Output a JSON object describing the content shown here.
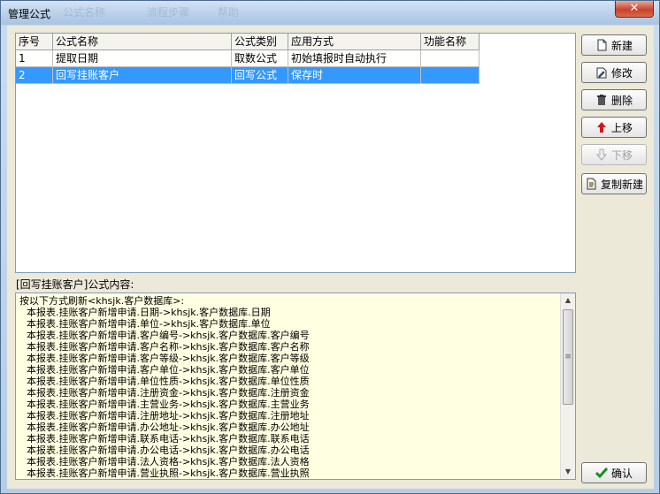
{
  "window": {
    "title": "管理公式",
    "ghost_texts": [
      "公式名称",
      "流程步骤",
      "帮助"
    ],
    "close_label": "✕"
  },
  "table": {
    "columns": [
      "序号",
      "公式名称",
      "公式类别",
      "应用方式",
      "功能名称"
    ],
    "rows": [
      [
        "1",
        "提取日期",
        "取数公式",
        "初始填报时自动执行",
        ""
      ],
      [
        "2",
        "回写挂账客户",
        "回写公式",
        "保存时",
        ""
      ]
    ],
    "selected_index": 1
  },
  "content_label": "[回写挂账客户]公式内容:",
  "content_lines": [
    "按以下方式刷新<khsjk.客户数据库>:",
    "本报表.挂账客户新增申请.日期->khsjk.客户数据库.日期",
    "本报表.挂账客户新增申请.单位->khsjk.客户数据库.单位",
    "本报表.挂账客户新增申请.客户编号->khsjk.客户数据库.客户编号",
    "本报表.挂账客户新增申请.客户名称->khsjk.客户数据库.客户名称",
    "本报表.挂账客户新增申请.客户等级->khsjk.客户数据库.客户等级",
    "本报表.挂账客户新增申请.客户单位->khsjk.客户数据库.客户单位",
    "本报表.挂账客户新增申请.单位性质->khsjk.客户数据库.单位性质",
    "本报表.挂账客户新增申请.注册资金->khsjk.客户数据库.注册资金",
    "本报表.挂账客户新增申请.主营业务->khsjk.客户数据库.主营业务",
    "本报表.挂账客户新增申请.注册地址->khsjk.客户数据库.注册地址",
    "本报表.挂账客户新增申请.办公地址->khsjk.客户数据库.办公地址",
    "本报表.挂账客户新增申请.联系电话->khsjk.客户数据库.联系电话",
    "本报表.挂账客户新增申请.办公电话->khsjk.客户数据库.办公电话",
    "本报表.挂账客户新增申请.法人资格->khsjk.客户数据库.法人资格",
    "本报表.挂账客户新增申请.营业执照->khsjk.客户数据库.营业执照"
  ],
  "buttons": {
    "new": "新建",
    "modify": "修改",
    "delete": "删除",
    "move_up": "上移",
    "move_down": "下移",
    "copy_new": "复制新建",
    "confirm": "确认"
  },
  "colors": {
    "selection": "#3399ff",
    "content_bg": "#ffffe1",
    "confirm_check": "#1a8f1a",
    "up_arrow": "#d01818"
  }
}
